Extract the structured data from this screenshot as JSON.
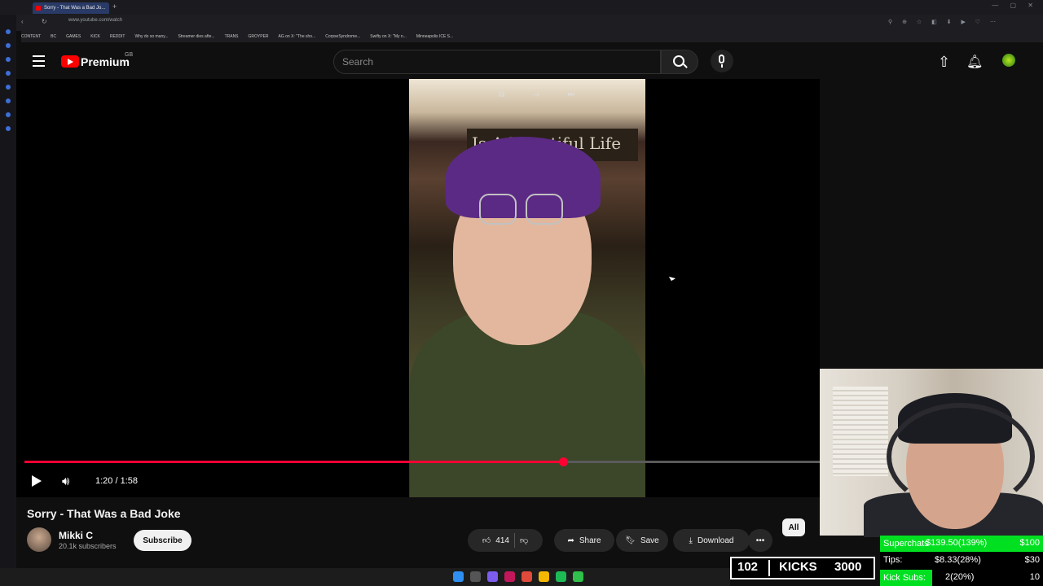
{
  "browser": {
    "tab_title": "Sorry - That Was a Bad Jo...",
    "new_tab": "+",
    "url": "www.youtube.com/watch",
    "bookmarks": [
      "CONTENT",
      "BC",
      "GAMES",
      "KICK",
      "REDDIT",
      "Why do so many...",
      "Streamer dies afte...",
      "TRANS",
      "GROYPER",
      "AG on X: \"The sho...",
      "CorpseSyndrome...",
      "Swifty on X: \"My n...",
      "Minneapolis ICE S..."
    ]
  },
  "header": {
    "brand": "Premium",
    "region": "GB",
    "search_placeholder": "Search"
  },
  "player": {
    "time": "1:20 / 1:58",
    "progress": 0.678,
    "sign_text": "Is A Beautiful Life"
  },
  "video": {
    "title": "Sorry - That Was a Bad Joke",
    "channel": "Mikki C",
    "subscribers": "20.1k subscribers",
    "subscribe_label": "Subscribe",
    "likes": "414",
    "share_label": "Share",
    "save_label": "Save",
    "download_label": "Download",
    "more_label": "•••",
    "chip_all": "All"
  },
  "overlay": {
    "kicks_count": "102",
    "kicks_label": "KICKS",
    "kicks_goal": "3000",
    "goals": [
      {
        "label": "Superchats",
        "value": "$139.50(139%)",
        "target": "$100"
      },
      {
        "label": "Tips:",
        "value": "$8.33(28%)",
        "target": "$30"
      },
      {
        "label": "Kick Subs:",
        "value": "2(20%)",
        "target": "10"
      }
    ]
  },
  "colors": {
    "youtube_red": "#ff0000",
    "progress_red": "#ff0033",
    "goal_green": "#00e021"
  }
}
